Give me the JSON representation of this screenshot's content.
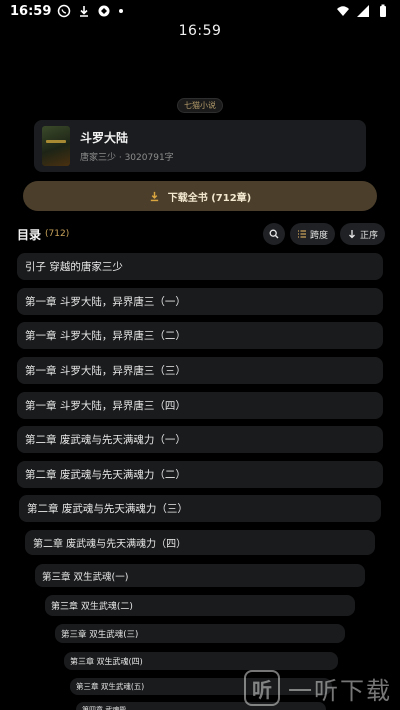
{
  "status_bar": {
    "time": "16:59"
  },
  "clock": "16:59",
  "source_tag": "七猫小说",
  "book": {
    "title": "斗罗大陆",
    "meta": "唐家三少 · 3020791字"
  },
  "download_button": {
    "label": "下载全书 (712章)"
  },
  "toc": {
    "title": "目录",
    "count": "(712)",
    "span_label": "跨度",
    "order_label": "正序"
  },
  "chapters": [
    "引子 穿越的唐家三少",
    "第一章 斗罗大陆，异界唐三（一）",
    "第一章 斗罗大陆，异界唐三（二）",
    "第一章 斗罗大陆，异界唐三（三）",
    "第一章 斗罗大陆，异界唐三（四）",
    "第二章 废武魂与先天满魂力（一）",
    "第二章 废武魂与先天满魂力（二）",
    "第二章 废武魂与先天满魂力（三）",
    "第二章 废武魂与先天满魂力（四）",
    "第三章 双生武魂(一)",
    "第三章 双生武魂(二)",
    "第三章 双生武魂(三)",
    "第三章 双生武魂(四)",
    "第三章 双生武魂(五)",
    "第四章 武魂殿"
  ],
  "watermark": {
    "logo_text": "听",
    "text": "一听下载"
  },
  "colors": {
    "accent": "#c9a35a",
    "button": "#4b3e2a",
    "card": "#1a1b1d"
  }
}
